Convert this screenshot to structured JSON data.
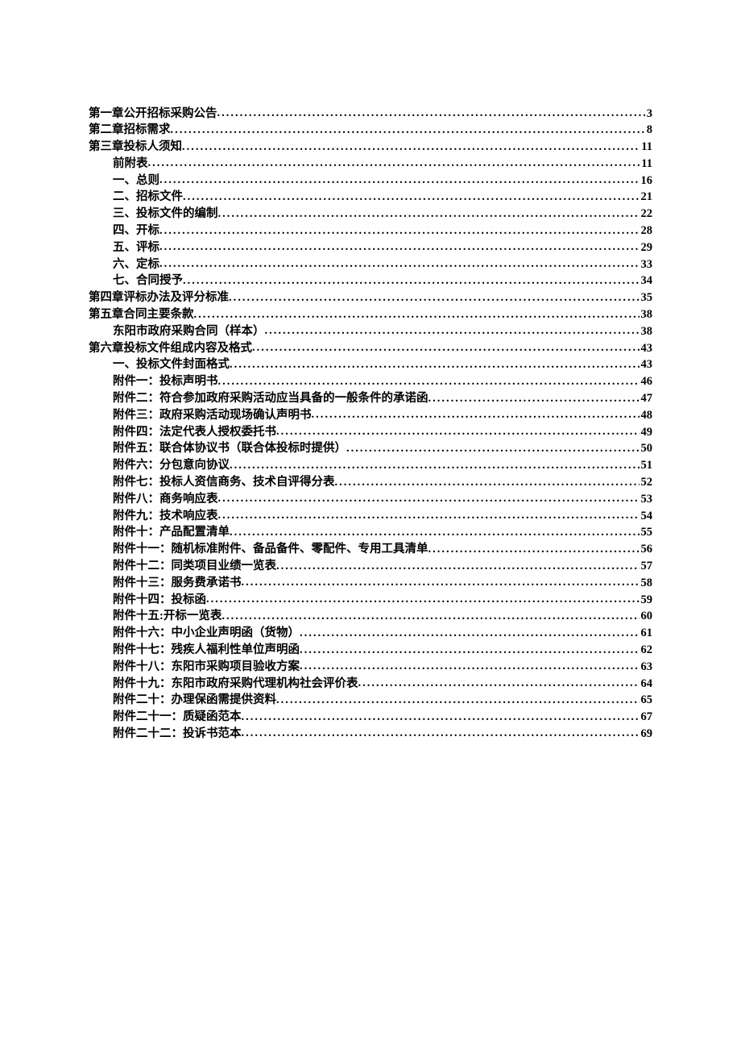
{
  "toc": [
    {
      "label": "第一章公开招标采购公告",
      "page": "3",
      "indent": 0
    },
    {
      "label": "第二章招标需求",
      "page": "8",
      "indent": 0
    },
    {
      "label": "第三章投标人须知",
      "page": "11",
      "indent": 0
    },
    {
      "label": "前附表",
      "page": "11",
      "indent": 1
    },
    {
      "label": "一、总则",
      "page": "16",
      "indent": 1
    },
    {
      "label": "二、招标文件",
      "page": "21",
      "indent": 1
    },
    {
      "label": "三、投标文件的编制",
      "page": "22",
      "indent": 1
    },
    {
      "label": "四、开标",
      "page": "28",
      "indent": 1
    },
    {
      "label": "五、评标",
      "page": "29",
      "indent": 1
    },
    {
      "label": "六、定标",
      "page": "33",
      "indent": 1
    },
    {
      "label": "七、合同授予",
      "page": "34",
      "indent": 1
    },
    {
      "label": "第四章评标办法及评分标准",
      "page": "35",
      "indent": 0
    },
    {
      "label": "第五章合同主要条款",
      "page": "38",
      "indent": 0
    },
    {
      "label": "东阳市政府采购合同（样本）",
      "page": "38",
      "indent": 1
    },
    {
      "label": "第六章投标文件组成内容及格式",
      "page": "43",
      "indent": 0
    },
    {
      "label": "一、投标文件封面格式",
      "page": "43",
      "indent": 1
    },
    {
      "label": "附件一：投标声明书",
      "page": "46",
      "indent": 1
    },
    {
      "label": "附件二：符合参加政府采购活动应当具备的一般条件的承诺函",
      "page": "47",
      "indent": 1
    },
    {
      "label": "附件三：政府采购活动现场确认声明书",
      "page": "48",
      "indent": 1
    },
    {
      "label": "附件四：法定代表人授权委托书",
      "page": "49",
      "indent": 1
    },
    {
      "label": "附件五：联合体协议书（联合体投标时提供）",
      "page": "50",
      "indent": 1
    },
    {
      "label": "附件六：分包意向协议",
      "page": "51",
      "indent": 1
    },
    {
      "label": "附件七：投标人资信商务、技术自评得分表",
      "page": "52",
      "indent": 1
    },
    {
      "label": "附件八：商务响应表",
      "page": "53",
      "indent": 1
    },
    {
      "label": "附件九：技术响应表",
      "page": "54",
      "indent": 1
    },
    {
      "label": "附件十：产品配置清单",
      "page": "55",
      "indent": 1
    },
    {
      "label": "附件十一：随机标准附件、备品备件、零配件、专用工具清单",
      "page": "56",
      "indent": 1
    },
    {
      "label": "附件十二：同类项目业绩一览表",
      "page": "57",
      "indent": 1
    },
    {
      "label": "附件十三：服务费承诺书",
      "page": "58",
      "indent": 1
    },
    {
      "label": "附件十四：投标函",
      "page": "59",
      "indent": 1
    },
    {
      "label": "附件十五:开标一览表",
      "page": "60",
      "indent": 1
    },
    {
      "label": "附件十六：中小企业声明函（货物）",
      "page": "61",
      "indent": 1
    },
    {
      "label": "附件十七：残疾人福利性单位声明函",
      "page": "62",
      "indent": 1
    },
    {
      "label": "附件十八：东阳市采购项目验收方案",
      "page": "63",
      "indent": 1
    },
    {
      "label": "附件十九：东阳市政府采购代理机构社会评价表",
      "page": "64",
      "indent": 1
    },
    {
      "label": "附件二十：办理保函需提供资料",
      "page": "65",
      "indent": 1
    },
    {
      "label": "附件二十一：质疑函范本",
      "page": "67",
      "indent": 1
    },
    {
      "label": "附件二十二：投诉书范本",
      "page": "69",
      "indent": 1
    }
  ]
}
